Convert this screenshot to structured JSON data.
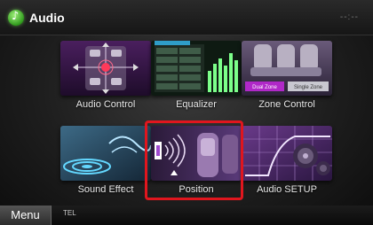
{
  "header": {
    "title": "Audio",
    "app_icon": "music-note-icon",
    "clock": "--:--"
  },
  "tiles": [
    {
      "label": "Audio Control",
      "icon": "speaker-fader-icon"
    },
    {
      "label": "Equalizer",
      "icon": "equalizer-sliders-icon"
    },
    {
      "label": "Zone Control",
      "icon": "car-seats-zone-icon",
      "buttons": [
        "Dual Zone",
        "Single Zone"
      ]
    },
    {
      "label": "Sound Effect",
      "icon": "sound-wave-icon"
    },
    {
      "label": "Position",
      "icon": "listening-position-icon",
      "selected": true
    },
    {
      "label": "Audio SETUP",
      "icon": "speaker-crossover-icon"
    }
  ],
  "bottom": {
    "menu_label": "Menu",
    "status_text": "TEL"
  },
  "colors": {
    "selection": "#e0161e",
    "accent_purple": "#a04ad0",
    "logo_green": "#2f9a1c"
  }
}
